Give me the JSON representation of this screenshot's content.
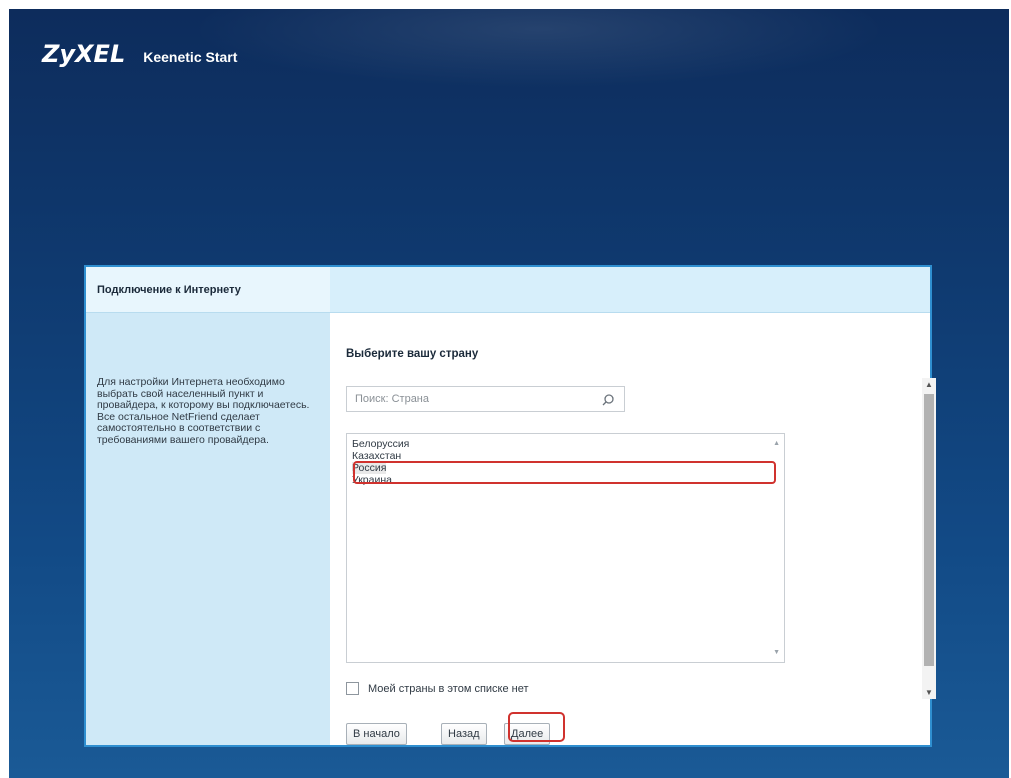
{
  "header": {
    "brand": "ZyXEL",
    "product": "Keenetic Start"
  },
  "sidebar": {
    "tab_label": "Подключение к Интернету",
    "description": "Для настройки Интернета необходимо выбрать свой населенный пункт и провайдера, к которому вы подключаетесь. Все остальное NetFriend сделает самостоятельно в соответствии с требованиями вашего провайдера."
  },
  "main": {
    "title": "Выберите вашу страну",
    "search": {
      "placeholder": "Поиск: Страна",
      "icon": "search-icon"
    },
    "countries": [
      {
        "label": "Белоруссия",
        "selected": false
      },
      {
        "label": "Казахстан",
        "selected": false
      },
      {
        "label": "Россия",
        "selected": true
      },
      {
        "label": "Украина",
        "selected": false
      }
    ],
    "not_in_list_label": "Моей страны в этом списке нет",
    "not_in_list_checked": false
  },
  "buttons": {
    "start": "В начало",
    "back": "Назад",
    "next": "Далее"
  },
  "colors": {
    "background": "#0f3a70",
    "dialog_border": "#2f8fd0",
    "sidebar": "#cfe9f7",
    "highlight": "#d0322e"
  }
}
